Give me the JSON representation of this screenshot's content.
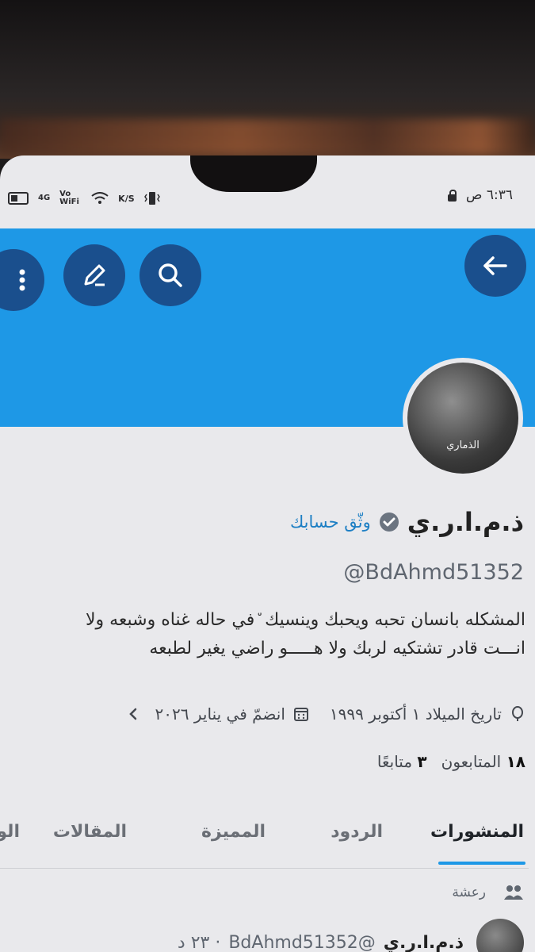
{
  "status_bar": {
    "time": "٦:٣٦ ص",
    "network": "4G",
    "volte": "Vo WiFi",
    "speed": "K/S"
  },
  "header": {
    "back_icon": "arrow-right-icon",
    "search_icon": "search-icon",
    "edit_icon": "pencil-icon",
    "more_icon": "more-vertical-icon",
    "banner_color": "#1e98e6"
  },
  "profile": {
    "avatar_caption": "الذماري",
    "display_name": "ذ.م.ا.ر.ي",
    "verify_link": "وثّق حسابك",
    "handle": "@BdAhmd51352",
    "bio_line1": "المشكله بانسان تحبه ويحبك وينسيك ٘في حاله غناه وشبعه  ولا",
    "bio_line2": "انـــت قادر تشتكيه لربك  ولا هـــــو راضي يغير لطبعه",
    "birthday": "تاريخ الميلاد ١ أكتوبر ١٩٩٩",
    "joined": "انضمّ في يناير ٢٠٢٦",
    "followers_count": "١٨",
    "followers_label": "المتابعون",
    "following_count": "٣",
    "following_label": "متابعًا"
  },
  "tabs": [
    {
      "label": "المنشورات",
      "active": true
    },
    {
      "label": "الردود",
      "active": false
    },
    {
      "label": "المميزة",
      "active": false
    },
    {
      "label": "المقالات",
      "active": false
    },
    {
      "label": "الو",
      "active": false
    }
  ],
  "post": {
    "context_label": "رعشة",
    "author_name": "ذ.م.ا.ر.ي",
    "author_handle": "@BdAhmd51352",
    "time": "· ٢٣ د"
  },
  "colors": {
    "accent": "#1e98e6",
    "button_bg": "#1a4f8d",
    "verified": "#1d7fc4"
  }
}
